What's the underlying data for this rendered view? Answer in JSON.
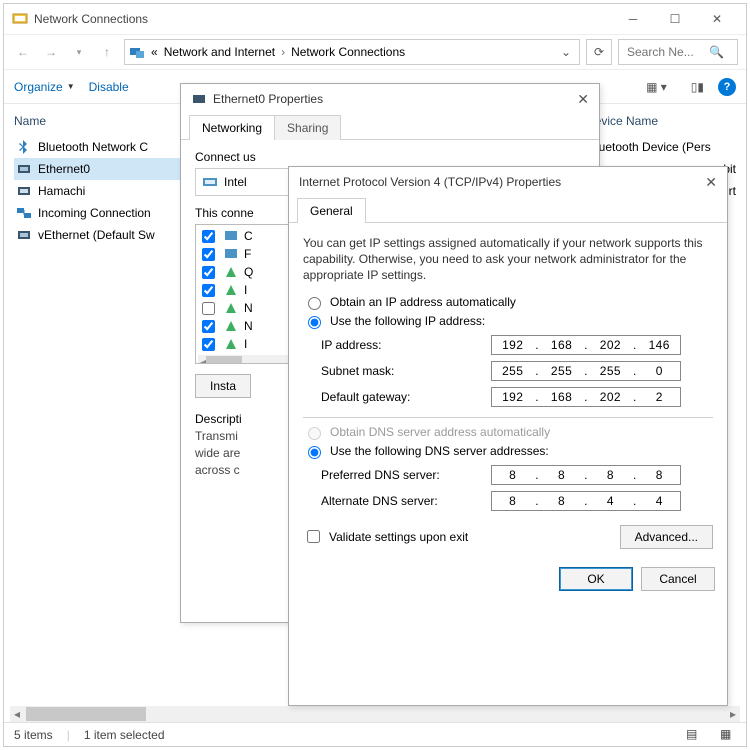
{
  "mainWindow": {
    "title": "Network Connections",
    "breadcrumb": {
      "chev": "«",
      "seg1": "Network and Internet",
      "seg2": "Network Connections"
    },
    "searchPlaceholder": "Search Ne...",
    "toolbar": {
      "organize": "Organize",
      "disable": "Disable"
    },
    "columns": {
      "name": "Name",
      "device": "Device Name"
    },
    "rows": {
      "r0": "Bluetooth Network C",
      "r1": "Ethernet0",
      "r2": "Hamachi",
      "r3": "Incoming Connection",
      "r4": "vEthernet (Default Sw"
    },
    "devrows": {
      "d0": "Bluetooth Device (Pers",
      "d1": "bit",
      "d2": "Virt"
    },
    "status": {
      "count": "5 items",
      "selected": "1 item selected"
    }
  },
  "ethDialog": {
    "title": "Ethernet0 Properties",
    "tabs": {
      "t0": "Networking",
      "t1": "Sharing"
    },
    "connectLabel": "Connect us",
    "adapterLabel": "Intel",
    "itemsLabel": "This conne",
    "items": {
      "i0": "C",
      "i1": "F",
      "i2": "Q",
      "i3": "I",
      "i4": "N",
      "i5": "N",
      "i6": "I"
    },
    "installBtn": "Insta",
    "descLabel": "Descripti",
    "descBody": "Transmi\nwide are\nacross c"
  },
  "ipDialog": {
    "title": "Internet Protocol Version 4 (TCP/IPv4) Properties",
    "tab": "General",
    "info": "You can get IP settings assigned automatically if your network supports this capability. Otherwise, you need to ask your network administrator for the appropriate IP settings.",
    "radioAuto": "Obtain an IP address automatically",
    "radioManual": "Use the following IP address:",
    "ipLabel": "IP address:",
    "subnetLabel": "Subnet mask:",
    "gatewayLabel": "Default gateway:",
    "ip": {
      "a": "192",
      "b": "168",
      "c": "202",
      "d": "146"
    },
    "subnet": {
      "a": "255",
      "b": "255",
      "c": "255",
      "d": "0"
    },
    "gateway": {
      "a": "192",
      "b": "168",
      "c": "202",
      "d": "2"
    },
    "dnsAuto": "Obtain DNS server address automatically",
    "dnsManual": "Use the following DNS server addresses:",
    "prefLabel": "Preferred DNS server:",
    "altLabel": "Alternate DNS server:",
    "dns1": {
      "a": "8",
      "b": "8",
      "c": "8",
      "d": "8"
    },
    "dns2": {
      "a": "8",
      "b": "8",
      "c": "4",
      "d": "4"
    },
    "validate": "Validate settings upon exit",
    "advanced": "Advanced...",
    "ok": "OK",
    "cancel": "Cancel"
  }
}
